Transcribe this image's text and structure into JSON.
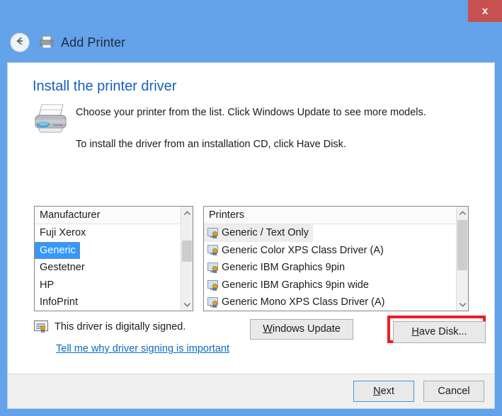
{
  "window": {
    "title": "Add Printer",
    "close_label": "x",
    "back_icon": "back-arrow-icon",
    "title_icon": "printer-icon",
    "accent_color": "#64a2ea",
    "close_color": "#c75050"
  },
  "content": {
    "heading": "Install the printer driver",
    "heading_color": "#1560bd",
    "illustration_icon": "printer-illustration-icon",
    "intro_line_1": "Choose your printer from the list. Click Windows Update to see more models.",
    "intro_line_2": "To install the driver from an installation CD, click Have Disk."
  },
  "manufacturer_list": {
    "header": "Manufacturer",
    "selected": "Generic",
    "selection_color": "#3399ff",
    "items": [
      {
        "label": "Fuji Xerox",
        "selected": false
      },
      {
        "label": "Generic",
        "selected": true
      },
      {
        "label": "Gestetner",
        "selected": false
      },
      {
        "label": "HP",
        "selected": false
      },
      {
        "label": "InfoPrint",
        "selected": false
      }
    ]
  },
  "printer_list": {
    "header": "Printers",
    "selected": "Generic / Text Only",
    "selection_color": "#ededed",
    "items": [
      {
        "label": "Generic / Text Only",
        "selected": true,
        "icon": "driver-certificate-icon"
      },
      {
        "label": "Generic Color XPS Class Driver (A)",
        "selected": false,
        "icon": "driver-certificate-icon"
      },
      {
        "label": "Generic IBM Graphics 9pin",
        "selected": false,
        "icon": "driver-certificate-icon"
      },
      {
        "label": "Generic IBM Graphics 9pin wide",
        "selected": false,
        "icon": "driver-certificate-icon"
      },
      {
        "label": "Generic Mono XPS Class Driver (A)",
        "selected": false,
        "icon": "driver-certificate-icon"
      }
    ]
  },
  "signature": {
    "icon": "certificate-icon",
    "text": "This driver is digitally signed.",
    "link_text": "Tell me why driver signing is important",
    "link_color": "#0a6ac4"
  },
  "actions": {
    "windows_update_accel": "W",
    "windows_update_rest": "indows Update",
    "have_disk_accel": "H",
    "have_disk_rest": "ave Disk...",
    "highlight_color": "#ee1c24"
  },
  "footer": {
    "next_accel": "N",
    "next_rest": "ext",
    "cancel_label": "Cancel",
    "default_button_border": "#3d99e0"
  }
}
